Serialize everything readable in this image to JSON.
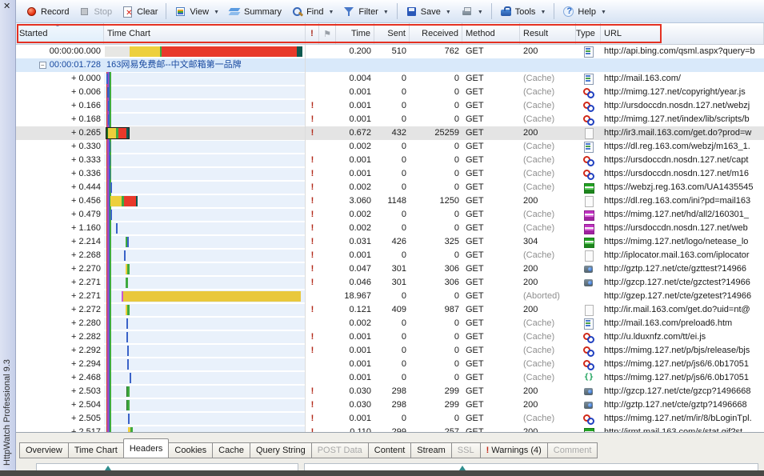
{
  "window": {
    "title": "HttpWatch Professional 9.3",
    "close_glyph": "✕"
  },
  "symbols": {
    "warning": "!",
    "collapse": "−",
    "sort_asc": "▲",
    "flag": "⚑",
    "dropdown": "▼"
  },
  "colors": {
    "highlight": "#e43122",
    "group_text": "#17489f",
    "warning": "#b22818",
    "event_lines": [
      "#cc3a2e",
      "#a84fc8",
      "#3a62c8",
      "#3faa3f"
    ]
  },
  "toolbar": {
    "items": [
      {
        "type": "button",
        "icon": "record",
        "label": "Record"
      },
      {
        "type": "button",
        "icon": "stop",
        "label": "Stop",
        "disabled": true
      },
      {
        "type": "button",
        "icon": "clear",
        "label": "Clear"
      },
      {
        "type": "sep"
      },
      {
        "type": "button",
        "icon": "view",
        "label": "View",
        "dropdown": true
      },
      {
        "type": "button",
        "icon": "summary",
        "label": "Summary"
      },
      {
        "type": "button",
        "icon": "find",
        "label": "Find",
        "dropdown": true
      },
      {
        "type": "button",
        "icon": "filter",
        "label": "Filter",
        "dropdown": true
      },
      {
        "type": "sep"
      },
      {
        "type": "button",
        "icon": "save",
        "label": "Save",
        "dropdown": true
      },
      {
        "type": "button",
        "icon": "print",
        "label": "",
        "dropdown": true
      },
      {
        "type": "sep"
      },
      {
        "type": "button",
        "icon": "tools",
        "label": "Tools",
        "dropdown": true
      },
      {
        "type": "sep"
      },
      {
        "type": "button",
        "icon": "help",
        "label": "Help",
        "dropdown": true
      }
    ]
  },
  "columns": [
    {
      "key": "started",
      "label": "Started",
      "sorted": true
    },
    {
      "key": "chart",
      "label": "Time Chart"
    },
    {
      "key": "warn",
      "label": "!"
    },
    {
      "key": "flag",
      "label": ""
    },
    {
      "key": "time",
      "label": "Time",
      "numeric": true
    },
    {
      "key": "sent",
      "label": "Sent",
      "numeric": true
    },
    {
      "key": "received",
      "label": "Received",
      "numeric": true
    },
    {
      "key": "method",
      "label": "Method"
    },
    {
      "key": "result",
      "label": "Result"
    },
    {
      "key": "type",
      "label": "Type"
    },
    {
      "key": "url",
      "label": "URL"
    }
  ],
  "rows": [
    {
      "kind": "page",
      "started": "00:00:00.000",
      "warn": false,
      "time": "0.200",
      "sent": "510",
      "received": "762",
      "method": "GET",
      "result": "200",
      "type": "html",
      "url": "http://api.bing.com/qsml.aspx?query=b",
      "bar": {
        "x": 1,
        "s": [
          [
            "#e7e7e4",
            31
          ],
          [
            "#edd03e",
            38
          ],
          [
            "#3faa3f",
            2
          ],
          [
            "#e8392a",
            169
          ],
          [
            "#0f5a50",
            7
          ]
        ]
      }
    },
    {
      "kind": "group",
      "started": "00:00:01.728",
      "title": "163网易免费邮--中文邮箱第一品牌"
    },
    {
      "kind": "req",
      "started": "+ 0.000",
      "warn": false,
      "time": "0.004",
      "sent": "0",
      "received": "0",
      "method": "GET",
      "result": "(Cache)",
      "type": "html",
      "url": "http://mail.163.com/",
      "bar": {
        "x": 3,
        "s": [
          [
            "#3a62c8",
            2
          ]
        ]
      }
    },
    {
      "kind": "req",
      "started": "+ 0.006",
      "warn": false,
      "time": "0.001",
      "sent": "0",
      "received": "0",
      "method": "GET",
      "result": "(Cache)",
      "type": "js",
      "url": "http://mimg.127.net/copyright/year.js",
      "bar": {
        "x": 4,
        "s": [
          [
            "#3a62c8",
            2
          ]
        ]
      }
    },
    {
      "kind": "req",
      "started": "+ 0.166",
      "warn": true,
      "time": "0.001",
      "sent": "0",
      "received": "0",
      "method": "GET",
      "result": "(Cache)",
      "type": "js",
      "url": "http://ursdoccdn.nosdn.127.net/webzj",
      "bar": {
        "x": 5,
        "s": [
          [
            "#3a62c8",
            2
          ]
        ]
      }
    },
    {
      "kind": "req",
      "started": "+ 0.168",
      "warn": true,
      "time": "0.001",
      "sent": "0",
      "received": "0",
      "method": "GET",
      "result": "(Cache)",
      "type": "js",
      "url": "http://mimg.127.net/index/lib/scripts/b",
      "bar": {
        "x": 5,
        "s": [
          [
            "#3a62c8",
            2
          ]
        ]
      }
    },
    {
      "kind": "req",
      "started": "+ 0.265",
      "selected": true,
      "warn": true,
      "time": "0.672",
      "sent": "432",
      "received": "25259",
      "method": "GET",
      "result": "200",
      "type": "doc",
      "url": "http://ir3.mail.163.com/get.do?prod=w",
      "bar": {
        "x": 3,
        "sel": true,
        "s": [
          [
            "#1e6b1e",
            2
          ],
          [
            "#edcf3b",
            10
          ],
          [
            "#3faa3f",
            3
          ],
          [
            "#e8392a",
            10
          ],
          [
            "#0f5a50",
            3
          ]
        ]
      }
    },
    {
      "kind": "req",
      "started": "+ 0.330",
      "warn": false,
      "time": "0.002",
      "sent": "0",
      "received": "0",
      "method": "GET",
      "result": "(Cache)",
      "type": "html",
      "url": "https://dl.reg.163.com/webzj/m163_1.",
      "bar": {
        "x": 6,
        "s": [
          [
            "#3a62c8",
            2
          ]
        ]
      }
    },
    {
      "kind": "req",
      "started": "+ 0.333",
      "warn": true,
      "time": "0.001",
      "sent": "0",
      "received": "0",
      "method": "GET",
      "result": "(Cache)",
      "type": "js",
      "url": "https://ursdoccdn.nosdn.127.net/capt",
      "bar": {
        "x": 6,
        "s": [
          [
            "#3a62c8",
            2
          ]
        ]
      }
    },
    {
      "kind": "req",
      "started": "+ 0.336",
      "warn": true,
      "time": "0.001",
      "sent": "0",
      "received": "0",
      "method": "GET",
      "result": "(Cache)",
      "type": "js",
      "url": "https://ursdoccdn.nosdn.127.net/m16",
      "bar": {
        "x": 6,
        "s": [
          [
            "#3a62c8",
            2
          ]
        ]
      }
    },
    {
      "kind": "req",
      "started": "+ 0.444",
      "warn": true,
      "time": "0.002",
      "sent": "0",
      "received": "0",
      "method": "GET",
      "result": "(Cache)",
      "type": "img-green",
      "url": "https://webzj.reg.163.com/UA1435545",
      "bar": {
        "x": 8,
        "s": [
          [
            "#3a62c8",
            2
          ]
        ]
      }
    },
    {
      "kind": "req",
      "started": "+ 0.456",
      "warn": true,
      "time": "3.060",
      "sent": "1148",
      "received": "1250",
      "method": "GET",
      "result": "200",
      "type": "doc",
      "url": "https://dl.reg.163.com/ini?pd=mail163",
      "bar": {
        "x": 8,
        "s": [
          [
            "#edcf3b",
            14
          ],
          [
            "#3faa3f",
            3
          ],
          [
            "#e8392a",
            15
          ],
          [
            "#0f5a50",
            2
          ]
        ]
      }
    },
    {
      "kind": "req",
      "started": "+ 0.479",
      "warn": true,
      "time": "0.002",
      "sent": "0",
      "received": "0",
      "method": "GET",
      "result": "(Cache)",
      "type": "img-purple",
      "url": "https://mimg.127.net/hd/all2/160301_",
      "bar": {
        "x": 8,
        "s": [
          [
            "#3a62c8",
            2
          ]
        ]
      }
    },
    {
      "kind": "req",
      "started": "+ 1.160",
      "warn": true,
      "time": "0.002",
      "sent": "0",
      "received": "0",
      "method": "GET",
      "result": "(Cache)",
      "type": "img-purple",
      "url": "https://ursdoccdn.nosdn.127.net/web",
      "bar": {
        "x": 15,
        "s": [
          [
            "#3a62c8",
            2
          ]
        ]
      }
    },
    {
      "kind": "req",
      "started": "+ 2.214",
      "warn": true,
      "time": "0.031",
      "sent": "426",
      "received": "325",
      "method": "GET",
      "result": "304",
      "type": "img-green",
      "url": "https://mimg.127.net/logo/netease_lo",
      "bar": {
        "x": 27,
        "s": [
          [
            "#3faa3f",
            2
          ],
          [
            "#3a62c8",
            2
          ]
        ]
      }
    },
    {
      "kind": "req",
      "started": "+ 2.268",
      "warn": true,
      "time": "0.001",
      "sent": "0",
      "received": "0",
      "method": "GET",
      "result": "(Cache)",
      "type": "doc",
      "url": "http://iplocator.mail.163.com/iplocator",
      "bar": {
        "x": 25,
        "s": [
          [
            "#3a62c8",
            2
          ]
        ]
      }
    },
    {
      "kind": "req",
      "started": "+ 2.270",
      "warn": true,
      "time": "0.047",
      "sent": "301",
      "received": "306",
      "method": "GET",
      "result": "200",
      "type": "camera",
      "url": "http://gztp.127.net/cte/gzttest?14966",
      "bar": {
        "x": 27,
        "s": [
          [
            "#edcf3b",
            2
          ],
          [
            "#3faa3f",
            3
          ]
        ]
      }
    },
    {
      "kind": "req",
      "started": "+ 2.271",
      "warn": true,
      "time": "0.046",
      "sent": "301",
      "received": "306",
      "method": "GET",
      "result": "200",
      "type": "camera",
      "url": "http://gzcp.127.net/cte/gzctest?14966",
      "bar": {
        "x": 27,
        "s": [
          [
            "#3faa3f",
            3
          ]
        ]
      }
    },
    {
      "kind": "req",
      "started": "+ 2.271",
      "warn": false,
      "time": "18.967",
      "sent": "0",
      "received": "0",
      "method": "GET",
      "result": "(Aborted)",
      "type": "none",
      "url": "http://gzep.127.net/cte/gzetest?14966",
      "bar": {
        "x": 22,
        "s": [
          [
            "#c85ad0",
            2
          ],
          [
            "#e9c83c",
            222
          ]
        ]
      }
    },
    {
      "kind": "req",
      "started": "+ 2.272",
      "warn": true,
      "time": "0.121",
      "sent": "409",
      "received": "987",
      "method": "GET",
      "result": "200",
      "type": "doc",
      "url": "http://ir.mail.163.com/get.do?uid=nt@",
      "bar": {
        "x": 27,
        "s": [
          [
            "#edcf3b",
            2
          ],
          [
            "#3faa3f",
            3
          ]
        ]
      }
    },
    {
      "kind": "req",
      "started": "+ 2.280",
      "warn": false,
      "time": "0.002",
      "sent": "0",
      "received": "0",
      "method": "GET",
      "result": "(Cache)",
      "type": "html",
      "url": "http://mail.163.com/preload6.htm",
      "bar": {
        "x": 28,
        "s": [
          [
            "#3a62c8",
            2
          ]
        ]
      }
    },
    {
      "kind": "req",
      "started": "+ 2.282",
      "warn": true,
      "time": "0.001",
      "sent": "0",
      "received": "0",
      "method": "GET",
      "result": "(Cache)",
      "type": "js",
      "url": "http://u.lduxnfz.com/tt/ei.js",
      "bar": {
        "x": 28,
        "s": [
          [
            "#3a62c8",
            2
          ]
        ]
      }
    },
    {
      "kind": "req",
      "started": "+ 2.292",
      "warn": true,
      "time": "0.001",
      "sent": "0",
      "received": "0",
      "method": "GET",
      "result": "(Cache)",
      "type": "js",
      "url": "https://mimg.127.net/p/bjs/release/bjs",
      "bar": {
        "x": 29,
        "s": [
          [
            "#3a62c8",
            2
          ]
        ]
      }
    },
    {
      "kind": "req",
      "started": "+ 2.294",
      "warn": false,
      "time": "0.001",
      "sent": "0",
      "received": "0",
      "method": "GET",
      "result": "(Cache)",
      "type": "js",
      "url": "https://mimg.127.net/p/js6/6.0b17051",
      "bar": {
        "x": 29,
        "s": [
          [
            "#3a62c8",
            2
          ]
        ]
      }
    },
    {
      "kind": "req",
      "started": "+ 2.468",
      "warn": false,
      "time": "0.001",
      "sent": "0",
      "received": "0",
      "method": "GET",
      "result": "(Cache)",
      "type": "json",
      "url": "https://mimg.127.net/p/js6/6.0b17051",
      "bar": {
        "x": 32,
        "s": [
          [
            "#3a62c8",
            2
          ]
        ]
      }
    },
    {
      "kind": "req",
      "started": "+ 2.503",
      "warn": true,
      "time": "0.030",
      "sent": "298",
      "received": "299",
      "method": "GET",
      "result": "200",
      "type": "camera",
      "url": "http://gzcp.127.net/cte/gzcp?1496668",
      "bar": {
        "x": 28,
        "s": [
          [
            "#1e6b1e",
            1
          ],
          [
            "#3faa3f",
            3
          ]
        ]
      }
    },
    {
      "kind": "req",
      "started": "+ 2.504",
      "warn": true,
      "time": "0.030",
      "sent": "298",
      "received": "299",
      "method": "GET",
      "result": "200",
      "type": "camera",
      "url": "http://gztp.127.net/cte/gztp?1496668",
      "bar": {
        "x": 28,
        "s": [
          [
            "#1e6b1e",
            1
          ],
          [
            "#3faa3f",
            3
          ]
        ]
      }
    },
    {
      "kind": "req",
      "started": "+ 2.505",
      "warn": true,
      "time": "0.001",
      "sent": "0",
      "received": "0",
      "method": "GET",
      "result": "(Cache)",
      "type": "js",
      "url": "https://mimg.127.net/m/ir/8/bLoginTpl.",
      "bar": {
        "x": 30,
        "s": [
          [
            "#3a62c8",
            2
          ]
        ]
      }
    },
    {
      "kind": "req",
      "started": "+ 2.517",
      "warn": true,
      "time": "0.110",
      "sent": "299",
      "received": "257",
      "method": "GET",
      "result": "200",
      "type": "img-green",
      "url": "http://irmt.mail.163.com/s/stat.gif?st",
      "bar": {
        "x": 30,
        "s": [
          [
            "#edcf3b",
            3
          ],
          [
            "#3faa3f",
            3
          ]
        ]
      }
    }
  ],
  "tabs": [
    {
      "label": "Overview"
    },
    {
      "label": "Time Chart"
    },
    {
      "label": "Headers",
      "active": true
    },
    {
      "label": "Cookies"
    },
    {
      "label": "Cache"
    },
    {
      "label": "Query String"
    },
    {
      "label": "POST Data",
      "disabled": true
    },
    {
      "label": "Content"
    },
    {
      "label": "Stream"
    },
    {
      "label": "SSL",
      "disabled": true
    },
    {
      "label": "Warnings (4)",
      "warn": true
    },
    {
      "label": "Comment",
      "disabled": true
    }
  ]
}
